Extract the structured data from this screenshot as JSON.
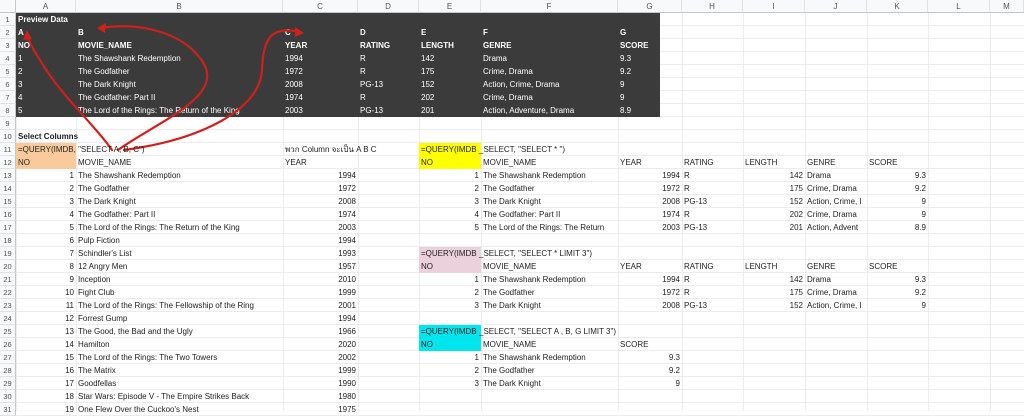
{
  "columns": [
    "A",
    "B",
    "C",
    "D",
    "E",
    "F",
    "G",
    "H",
    "I",
    "J",
    "K",
    "L",
    "M"
  ],
  "rows": [
    "1",
    "2",
    "3",
    "4",
    "5",
    "6",
    "7",
    "8",
    "9",
    "10",
    "11",
    "12",
    "13",
    "14",
    "15",
    "16",
    "17",
    "18",
    "19",
    "20",
    "21",
    "22",
    "23",
    "24",
    "25",
    "26",
    "27",
    "28",
    "29",
    "30",
    "31"
  ],
  "preview": {
    "title": "Preview Data",
    "letters": [
      "A",
      "B",
      "C",
      "D",
      "E",
      "F",
      "G"
    ],
    "headers": [
      "NO",
      "MOVIE_NAME",
      "YEAR",
      "RATING",
      "LENGTH",
      "GENRE",
      "SCORE"
    ],
    "data": [
      [
        "1",
        "The Shawshank Redemption",
        "1994",
        "R",
        "142",
        "Drama",
        "9.3"
      ],
      [
        "2",
        "The Godfather",
        "1972",
        "R",
        "175",
        "Crime, Drama",
        "9.2"
      ],
      [
        "3",
        "The Dark Knight",
        "2008",
        "PG-13",
        "152",
        "Action, Crime, Drama",
        "9"
      ],
      [
        "4",
        "The Godfather: Part II",
        "1974",
        "R",
        "202",
        "Crime, Drama",
        "9"
      ],
      [
        "5",
        "The Lord of the Rings: The Return of the King",
        "2003",
        "PG-13",
        "201",
        "Action, Adventure, Drama",
        "8.9"
      ]
    ]
  },
  "select_columns": {
    "title": "Select Columns",
    "formula": "=QUERY(IMDB, \"SELECT A, B, C\")",
    "note": "พวก Column จะเป็น A B C",
    "headers": [
      "NO",
      "MOVIE_NAME",
      "YEAR"
    ],
    "data": [
      [
        "1",
        "The Shawshank Redemption",
        "1994"
      ],
      [
        "2",
        "The Godfather",
        "1972"
      ],
      [
        "3",
        "The Dark Knight",
        "2008"
      ],
      [
        "4",
        "The Godfather: Part II",
        "1974"
      ],
      [
        "5",
        "The Lord of the Rings: The Return of the King",
        "2003"
      ],
      [
        "6",
        "Pulp Fiction",
        "1994"
      ],
      [
        "7",
        "Schindler's List",
        "1993"
      ],
      [
        "8",
        "12 Angry Men",
        "1957"
      ],
      [
        "9",
        "Inception",
        "2010"
      ],
      [
        "10",
        "Fight Club",
        "1999"
      ],
      [
        "11",
        "The Lord of the Rings: The Fellowship of the Ring",
        "2001"
      ],
      [
        "12",
        "Forrest Gump",
        "1994"
      ],
      [
        "13",
        "The Good, the Bad and the Ugly",
        "1966"
      ],
      [
        "14",
        "Hamilton",
        "2020"
      ],
      [
        "15",
        "The Lord of the Rings: The Two Towers",
        "2002"
      ],
      [
        "16",
        "The Matrix",
        "1999"
      ],
      [
        "17",
        "Goodfellas",
        "1990"
      ],
      [
        "18",
        "Star Wars: Episode V - The Empire Strikes Back",
        "1980"
      ],
      [
        "19",
        "One Flew Over the Cuckoo's Nest",
        "1975"
      ]
    ]
  },
  "query_all": {
    "formula_cell": "=QUERY(IMDB",
    "formula_rest": "_SELECT, \"SELECT * \")",
    "headers": [
      "NO",
      "MOVIE_NAME",
      "YEAR",
      "RATING",
      "LENGTH",
      "GENRE",
      "SCORE"
    ],
    "data": [
      [
        "1",
        "The Shawshank Redemption",
        "1994",
        "R",
        "142",
        "Drama",
        "9.3"
      ],
      [
        "2",
        "The Godfather",
        "1972",
        "R",
        "175",
        "Crime, Drama",
        "9.2"
      ],
      [
        "3",
        "The Dark Knight",
        "2008",
        "PG-13",
        "152",
        "Action, Crime, I",
        "9"
      ],
      [
        "4",
        "The Godfather: Part II",
        "1974",
        "R",
        "202",
        "Crime, Drama",
        "9"
      ],
      [
        "5",
        "The Lord of the Rings: The Return",
        "2003",
        "PG-13",
        "201",
        "Action, Advent",
        "8.9"
      ]
    ]
  },
  "query_limit": {
    "formula_cell": "=QUERY(IMDB",
    "formula_rest": "_SELECT, \"SELECT * LIMIT 3\")",
    "headers": [
      "NO",
      "MOVIE_NAME",
      "YEAR",
      "RATING",
      "LENGTH",
      "GENRE",
      "SCORE"
    ],
    "data": [
      [
        "1",
        "The Shawshank Redemption",
        "1994",
        "R",
        "142",
        "Drama",
        "9.3"
      ],
      [
        "2",
        "The Godfather",
        "1972",
        "R",
        "175",
        "Crime, Drama",
        "9.2"
      ],
      [
        "3",
        "The Dark Knight",
        "2008",
        "PG-13",
        "152",
        "Action, Crime, I",
        "9"
      ]
    ]
  },
  "query_abg": {
    "formula_cell": "=QUERY(IMDB",
    "formula_rest": "_SELECT, \"SELECT A , B, G LIMIT 3\")",
    "headers": [
      "NO",
      "MOVIE_NAME",
      "SCORE"
    ],
    "data": [
      [
        "1",
        "The Shawshank Redemption",
        "9.3"
      ],
      [
        "2",
        "The Godfather",
        "9.2"
      ],
      [
        "3",
        "The Dark Knight",
        "9"
      ]
    ]
  },
  "colors": {
    "header_fill": "#f8f9fa",
    "dark_fill": "#3b3b3b",
    "orange": "#f9cb9c",
    "yellow": "#ffff00",
    "pink": "#ead1dc",
    "cyan": "#00e5ee",
    "arrow": "#d0201a"
  }
}
